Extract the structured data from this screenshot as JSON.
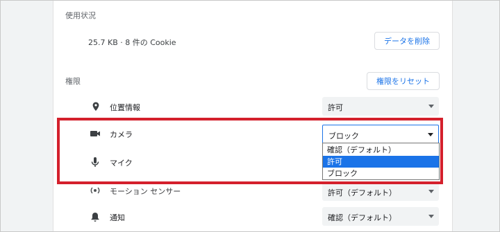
{
  "usage": {
    "heading": "使用状況",
    "summary": "25.7 KB · 8 件の Cookie",
    "clear_button": "データを削除"
  },
  "permissions": {
    "heading": "権限",
    "reset_button": "権限をリセット",
    "items": [
      {
        "icon": "location-pin-icon",
        "label": "位置情報",
        "value": "許可"
      },
      {
        "icon": "camera-icon",
        "label": "カメラ",
        "value": "ブロック"
      },
      {
        "icon": "microphone-icon",
        "label": "マイク",
        "value": ""
      },
      {
        "icon": "motion-sensor-icon",
        "label": "モーション センサー",
        "value": "許可（デフォルト）"
      },
      {
        "icon": "bell-icon",
        "label": "通知",
        "value": "確認（デフォルト）"
      }
    ],
    "camera_dropdown": {
      "options": [
        "確認（デフォルト）",
        "許可",
        "ブロック"
      ],
      "highlighted": "許可"
    }
  },
  "colors": {
    "accent": "#1a73e8",
    "highlight_frame": "#d4202c"
  }
}
